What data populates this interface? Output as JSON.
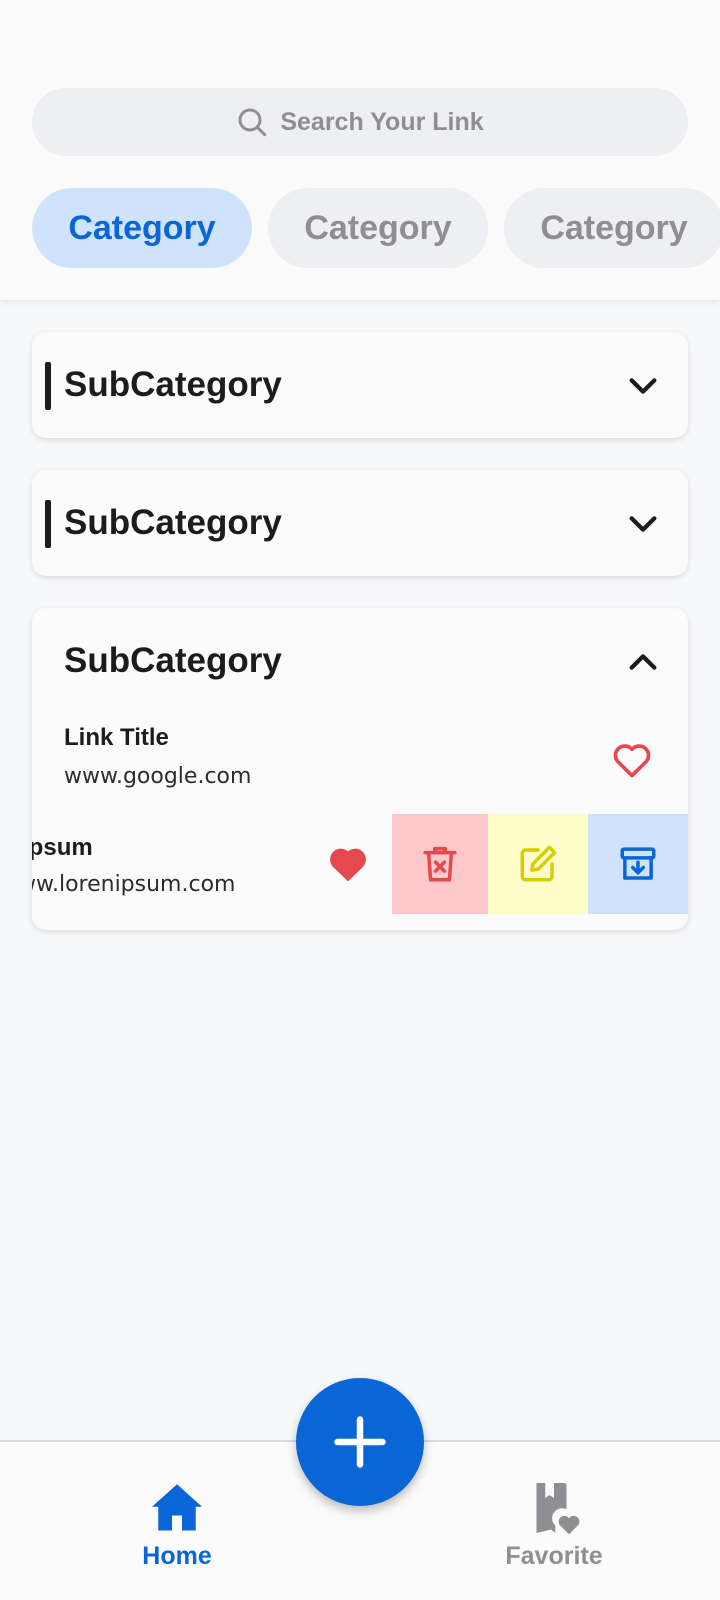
{
  "search": {
    "placeholder": "Search Your Link",
    "icon": "search-icon"
  },
  "categories": [
    {
      "label": "Category",
      "active": true
    },
    {
      "label": "Category",
      "active": false
    },
    {
      "label": "Category",
      "active": false
    }
  ],
  "subcategories": [
    {
      "title": "SubCategory",
      "expanded": false,
      "icon": "chevron-down-icon"
    },
    {
      "title": "SubCategory",
      "expanded": false,
      "icon": "chevron-down-icon"
    },
    {
      "title": "SubCategory",
      "expanded": true,
      "icon": "chevron-up-icon",
      "links": [
        {
          "title": "Link Title",
          "url": "www.google.com",
          "favorite": false
        },
        {
          "title": "Lorem Ipsum",
          "url": "www.lorenipsum.com",
          "favorite": true
        }
      ]
    }
  ],
  "swipe_actions": [
    "delete",
    "edit",
    "archive"
  ],
  "nav": {
    "home_label": "Home",
    "favorite_label": "Favorite"
  },
  "colors": {
    "accent": "#0a66d6",
    "accent_light": "#cfe4fc",
    "favorite": "#e5484d",
    "delete_bg": "#ffc9cb",
    "edit_bg": "#fffdc9",
    "edit_fg": "#d9cc00"
  }
}
